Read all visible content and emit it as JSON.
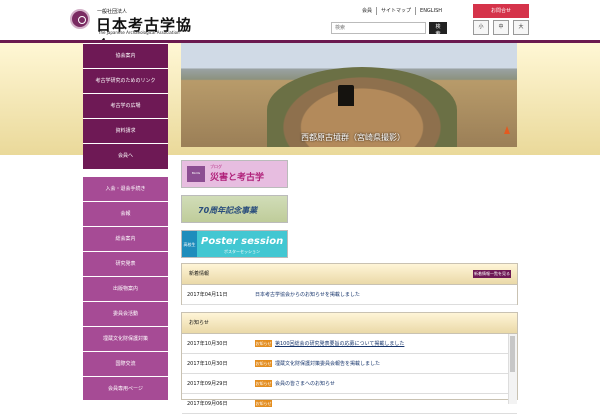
{
  "header": {
    "logo_small": "一般社団法人",
    "logo_main": "日本考古学協会",
    "logo_en": "The Japanese Archaeological Association",
    "top_links": [
      "会員",
      "サイトマップ",
      "ENGLISH"
    ],
    "search_placeholder": "検索",
    "search_button": "検索",
    "top_button": "お問合せ",
    "font_size": [
      "小",
      "中",
      "大"
    ]
  },
  "hero": {
    "caption": "西都原古墳群（宮崎県撮影）"
  },
  "sidebar_top": [
    "協会案内",
    "考古学研究のためのリンク",
    "考古学の広場",
    "資料請求",
    "会員へ"
  ],
  "sidebar_main": [
    "入会・退会手続き",
    "会報",
    "総会案内",
    "研究発表",
    "出版物案内",
    "委員会活動",
    "埋蔵文化財保護対策",
    "国際交流",
    "会員専用ページ"
  ],
  "banners": {
    "blog_label": "BLOG",
    "blog_small": "ブログ",
    "blog_title": "災害と考古学",
    "anniversary": "70周年記念事業",
    "poster_label": "高校生",
    "poster_title": "Poster session",
    "poster_sub": "ポスターセッション"
  },
  "news_box": {
    "title": "新着情報",
    "link": "新着情報一覧を見る",
    "rows": [
      {
        "date": "2017年04月11日",
        "text": "日本考古学協会からのお知らせを掲載しました"
      }
    ]
  },
  "info_box": {
    "title": "お知らせ",
    "rows": [
      {
        "date": "2017年10月30日",
        "tag": "お知らせ",
        "text": "第100回総会の研究発表要旨の応募について掲載しました"
      },
      {
        "date": "2017年10月30日",
        "tag": "お知らせ",
        "text": "埋蔵文化財保護対策委員会報告を掲載しました"
      },
      {
        "date": "2017年09月29日",
        "tag": "お知らせ",
        "text": "会員の皆さまへのお知らせ"
      },
      {
        "date": "2017年09月06日",
        "tag": "お知らせ",
        "text": ""
      }
    ]
  },
  "colors": {
    "brand": "#6e1955",
    "sidebar": "#a64b95",
    "accent": "#d5334a",
    "tag": "#e38d1f"
  }
}
